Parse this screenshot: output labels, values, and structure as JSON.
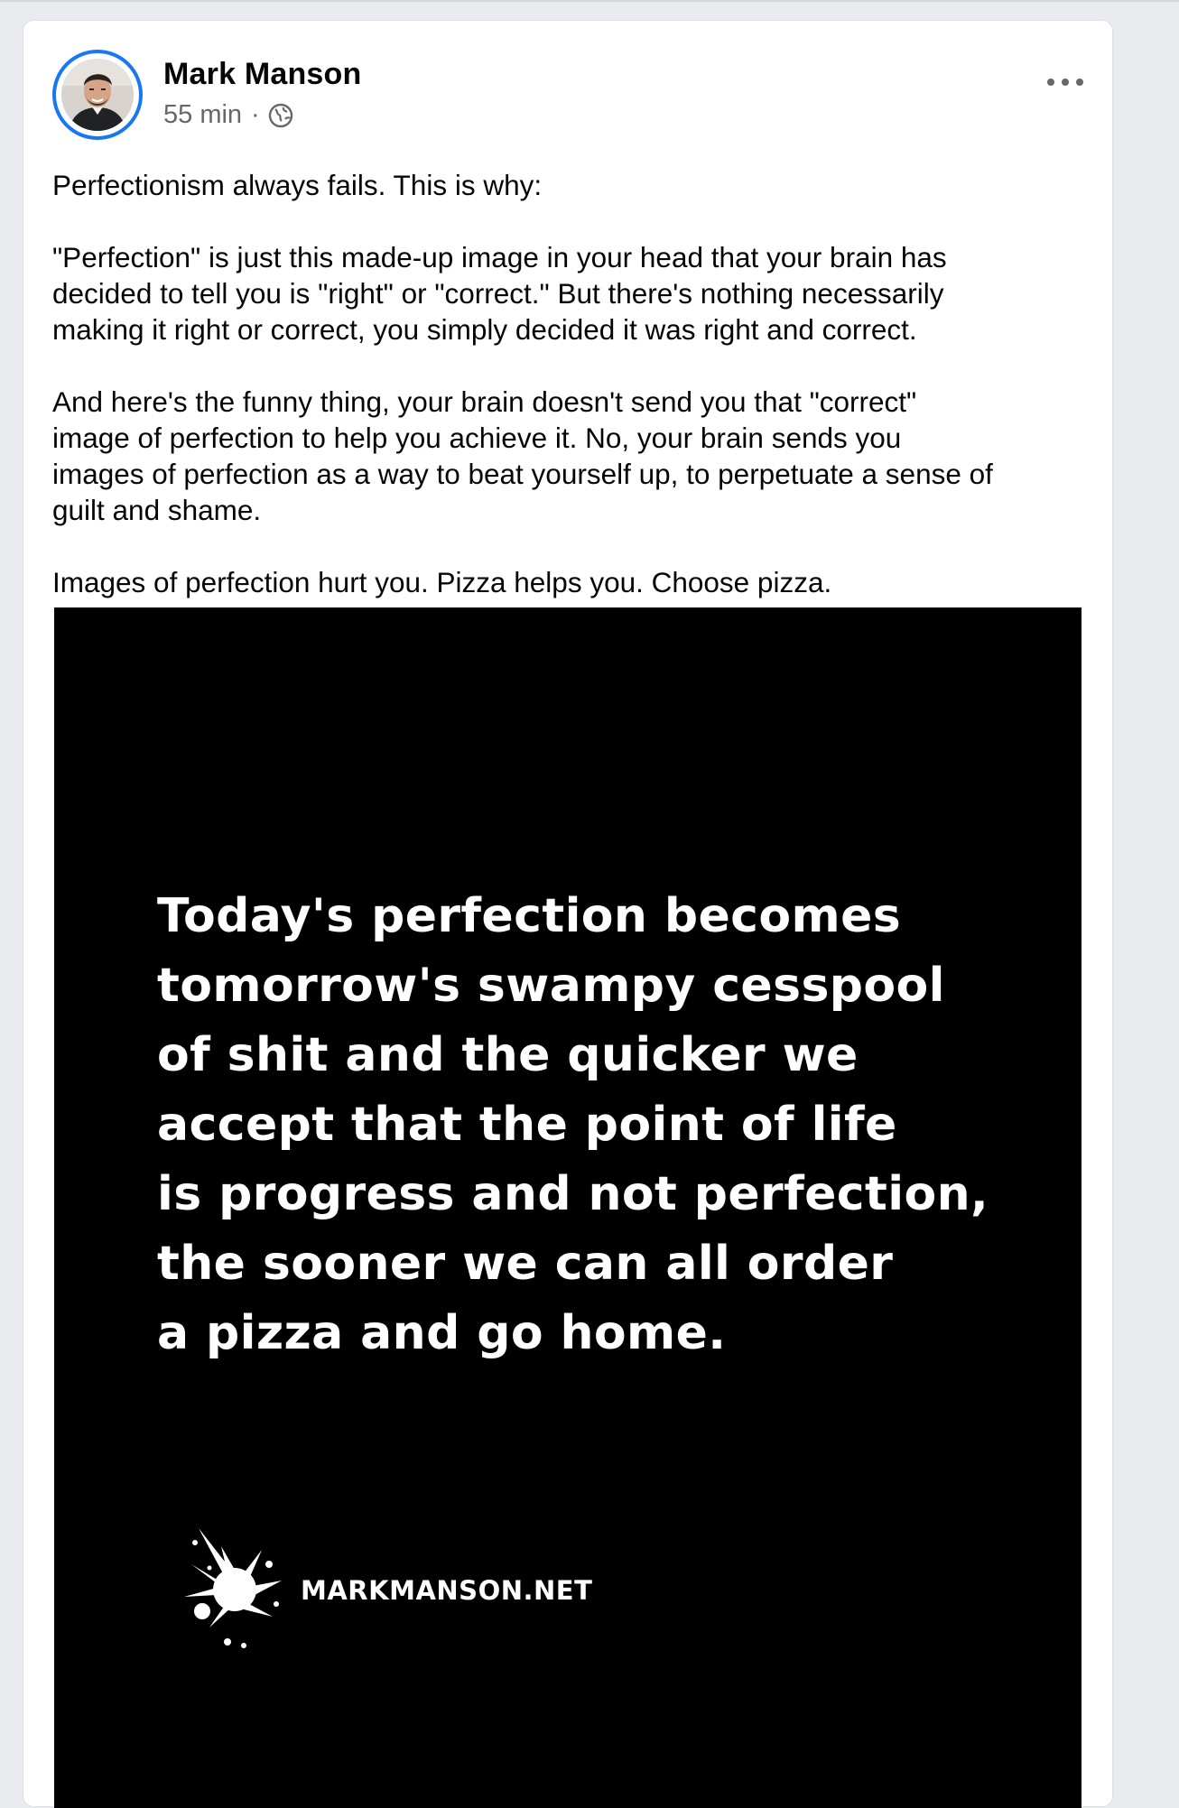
{
  "post": {
    "author": "Mark Manson",
    "time": "55 min",
    "separator": "·",
    "privacy_icon": "globe-icon",
    "more_icon": "more-options-icon",
    "accent_color": "#1877f2",
    "paragraphs": [
      [
        "Perfectionism always fails. This is why:"
      ],
      [
        "\"Perfection\" is just this made-up image in your head that your brain has",
        "decided to tell you is \"right\" or \"correct.\" But there's nothing necessarily",
        "making it right or correct, you simply decided it was right and correct."
      ],
      [
        "And here's the funny thing, your brain doesn't send you that \"correct\"",
        "image of perfection to help you achieve it. No, your brain sends you",
        "images of perfection as a way to beat yourself up, to perpetuate a sense of",
        "guilt and shame."
      ],
      [
        "Images of perfection hurt you. Pizza helps you. Choose pizza."
      ]
    ]
  },
  "image": {
    "quote_lines": [
      "Today's perfection becomes",
      "tomorrow's swampy cesspool",
      "of shit and the quicker we",
      "accept that the point of life",
      "is progress and not perfection,",
      "the sooner we can all order",
      "a pizza and go home."
    ],
    "site": "MARKMANSON.NET",
    "logo_icon": "ink-splat-icon"
  }
}
